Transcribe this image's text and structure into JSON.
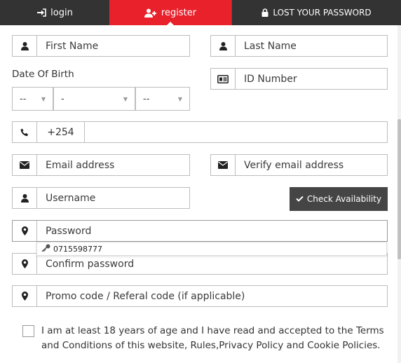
{
  "tabs": {
    "login": "login",
    "register": "register",
    "lost_password": "LOST YOUR PASSWORD"
  },
  "form": {
    "first_name_placeholder": "First Name",
    "last_name_placeholder": "Last Name",
    "dob_label": "Date Of Birth",
    "dob_day": "--",
    "dob_month": "-",
    "dob_year": "--",
    "id_number_placeholder": "ID Number",
    "phone_prefix": "+254",
    "phone_value": "",
    "email_placeholder": "Email address",
    "verify_email_placeholder": "Verify email address",
    "username_placeholder": "Username",
    "check_availability": "Check Availability",
    "password_placeholder": "Password",
    "confirm_password_placeholder": "Confirm password",
    "promo_placeholder": "Promo code / Referal code (if applicable)",
    "terms_text": "I am at least 18 years of age and I have read and accepted to the Terms and Conditions of this website, Rules,Privacy Policy and Cookie Policies."
  },
  "autofill": {
    "suggestion": "0715598777"
  },
  "icons": {
    "user": "user-icon",
    "id_card": "id-card-icon",
    "phone": "phone-icon",
    "envelope": "envelope-icon",
    "pin": "map-marker-icon",
    "key": "key-icon",
    "check": "check-icon",
    "lock": "lock-icon",
    "sign_in": "sign-in-icon",
    "user_plus": "user-plus-icon"
  },
  "colors": {
    "accent": "#e8212b",
    "dark": "#333333",
    "button": "#454545"
  }
}
